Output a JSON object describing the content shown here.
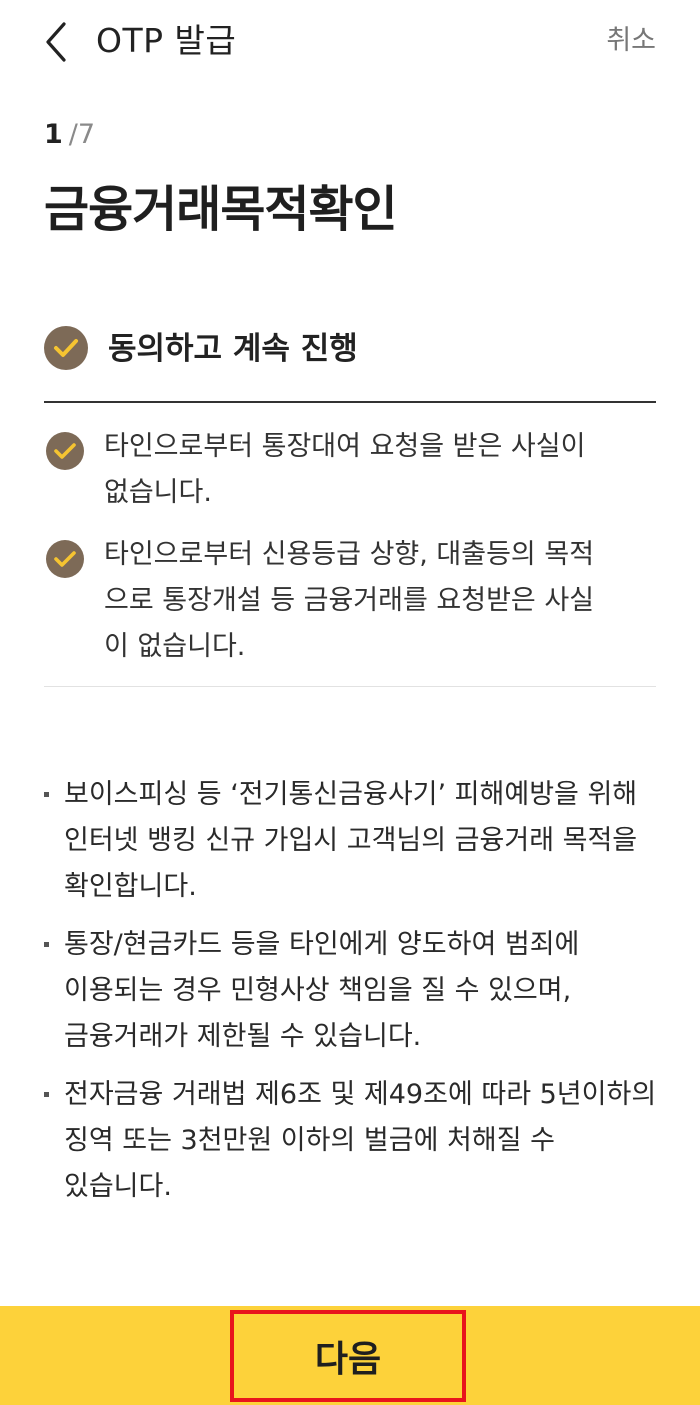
{
  "header": {
    "title": "OTP 발급",
    "cancel_label": "취소",
    "back_icon": "chevron-left-icon"
  },
  "step": {
    "current": "1",
    "separator": "/",
    "total": "7"
  },
  "page_title": "금융거래목적확인",
  "agreement": {
    "all_label": "동의하고 계속 진행",
    "check_icon": "check-circle-icon",
    "check_color": "#7d6a57",
    "check_mark_color": "#f5c431",
    "items": [
      {
        "label_lines": [
          "타인으로부터 통장대여 요청을 받은 사실이",
          "없습니다."
        ]
      },
      {
        "label_lines": [
          "타인으로부터 신용등급 상향, 대출등의 목적",
          "으로 통장개설 등 금융거래를 요청받은 사실",
          "이 없습니다."
        ]
      }
    ]
  },
  "notes": [
    {
      "lines": [
        "보이스피싱 등 ‘전기통신금융사기’ 피해예방을 위해",
        "인터넷 뱅킹 신규 가입시 고객님의 금융거래 목적을",
        "확인합니다."
      ]
    },
    {
      "lines": [
        "통장/현금카드 등을 타인에게 양도하여 범죄에",
        "이용되는 경우 민형사상 책임을 질 수 있으며,",
        "금융거래가 제한될 수 있습니다."
      ]
    },
    {
      "lines": [
        "전자금융 거래법 제6조 및 제49조에 따라 5년이하의",
        "징역 또는 3천만원 이하의 벌금에 처해질 수",
        "있습니다."
      ]
    }
  ],
  "footer": {
    "next_label": "다음",
    "bar_color": "#fdd23a",
    "highlight_color": "#e8141c"
  }
}
